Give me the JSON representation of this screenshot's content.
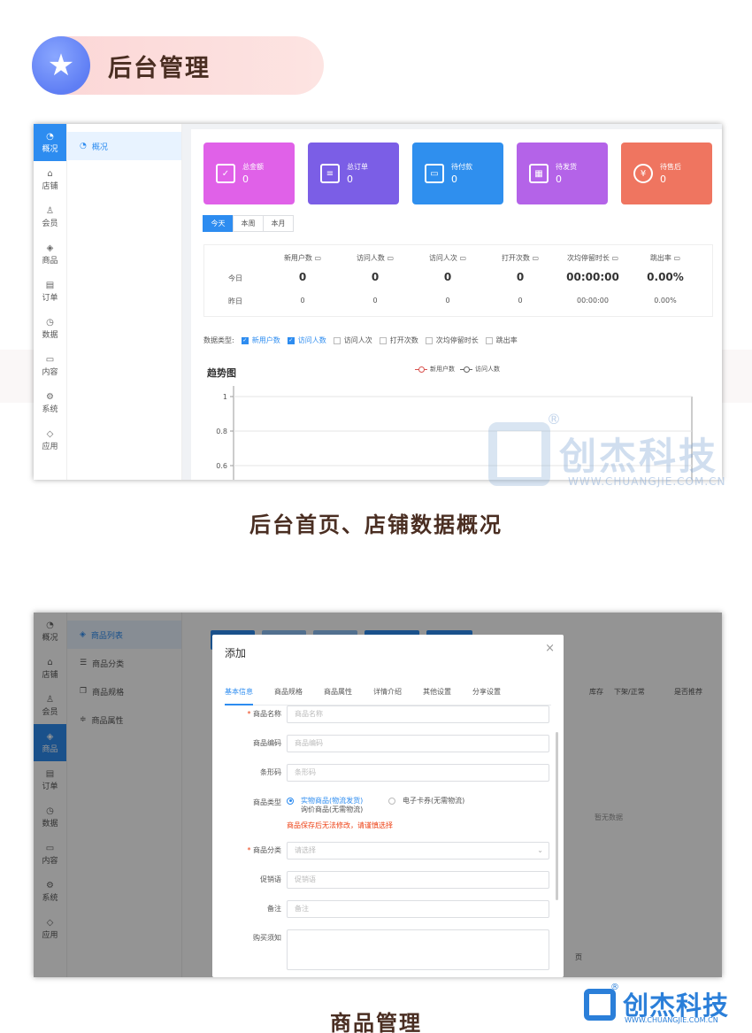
{
  "header": {
    "title": "后台管理",
    "icon": "star-icon"
  },
  "captions": {
    "first": "后台首页、店铺数据概况",
    "second": "商品管理"
  },
  "sidebar": {
    "items": [
      {
        "label": "概况",
        "icon": "gauge-icon"
      },
      {
        "label": "店铺",
        "icon": "store-icon"
      },
      {
        "label": "会员",
        "icon": "user-icon"
      },
      {
        "label": "商品",
        "icon": "cube-icon"
      },
      {
        "label": "订单",
        "icon": "clipboard-icon"
      },
      {
        "label": "数据",
        "icon": "clock-icon"
      },
      {
        "label": "内容",
        "icon": "folder-icon"
      },
      {
        "label": "系统",
        "icon": "gear-icon"
      },
      {
        "label": "应用",
        "icon": "package-icon"
      }
    ]
  },
  "screen1": {
    "subnav": {
      "items": [
        {
          "label": "概况",
          "icon": "gauge-icon"
        }
      ]
    },
    "stats": [
      {
        "label": "总金额",
        "value": "0",
        "color": "#e061e8",
        "icon": "check-square-icon"
      },
      {
        "label": "总订单",
        "value": "0",
        "color": "#7b5ee6",
        "icon": "list-icon"
      },
      {
        "label": "待付款",
        "value": "0",
        "color": "#2f8fee",
        "icon": "wallet-icon"
      },
      {
        "label": "待发货",
        "value": "0",
        "color": "#b463e8",
        "icon": "box-icon"
      },
      {
        "label": "待售后",
        "value": "0",
        "color": "#ef7560",
        "icon": "yen-refresh-icon"
      }
    ],
    "range_tabs": [
      "今天",
      "本周",
      "本月"
    ],
    "range_active": "今天",
    "table": {
      "headers": [
        "新用户数",
        "访问人数",
        "访问人次",
        "打开次数",
        "次均停留时长",
        "跳出率"
      ],
      "rows": [
        {
          "label": "今日",
          "values": [
            "0",
            "0",
            "0",
            "0",
            "00:00:00",
            "0.00%"
          ]
        },
        {
          "label": "昨日",
          "values": [
            "0",
            "0",
            "0",
            "0",
            "00:00:00",
            "0.00%"
          ]
        }
      ]
    },
    "data_type": {
      "label": "数据类型:",
      "options": [
        {
          "label": "新用户数",
          "checked": true
        },
        {
          "label": "访问人数",
          "checked": true
        },
        {
          "label": "访问人次",
          "checked": false
        },
        {
          "label": "打开次数",
          "checked": false
        },
        {
          "label": "次均停留时长",
          "checked": false
        },
        {
          "label": "跳出率",
          "checked": false
        }
      ]
    }
  },
  "chart_data": {
    "type": "line",
    "title": "趋势图",
    "series": [
      {
        "name": "新用户数",
        "color": "#d9534f",
        "values": []
      },
      {
        "name": "访问人数",
        "color": "#666666",
        "values": []
      }
    ],
    "yticks": [
      "1",
      "0.8",
      "0.6"
    ],
    "ylim": [
      0.6,
      1
    ],
    "grid": true,
    "legend": "top-center"
  },
  "watermark": {
    "name": "创杰科技",
    "url": "WWW.CHUANGJIE.COM.CN",
    "reg": "®"
  },
  "screen2": {
    "subnav": {
      "items": [
        {
          "label": "商品列表",
          "icon": "cube-icon"
        },
        {
          "label": "商品分类",
          "icon": "menu-icon"
        },
        {
          "label": "商品规格",
          "icon": "copy-icon"
        },
        {
          "label": "商品属性",
          "icon": "sliders-icon"
        }
      ]
    },
    "background": {
      "columns": [
        "库存",
        "下架/正常",
        "是否推荐"
      ],
      "empty_text": "暂无数据",
      "page_text": "页"
    },
    "modal": {
      "title": "添加",
      "close": "×",
      "tabs": [
        "基本信息",
        "商品规格",
        "商品属性",
        "详情介绍",
        "其他设置",
        "分享设置"
      ],
      "fields": {
        "name": {
          "label": "商品名称",
          "placeholder": "商品名称",
          "required": "*"
        },
        "code": {
          "label": "商品编码",
          "placeholder": "商品编码"
        },
        "barcode": {
          "label": "条形码",
          "placeholder": "条形码"
        },
        "type": {
          "label": "商品类型",
          "options": [
            "实物商品(物流发货)",
            "电子卡券(无需物流)",
            "询价商品(无需物流)"
          ],
          "warning": "商品保存后无法修改，请谨慎选择"
        },
        "category": {
          "label": "商品分类",
          "placeholder": "请选择",
          "required": "*"
        },
        "promo": {
          "label": "促销语",
          "placeholder": "促销语"
        },
        "remark": {
          "label": "备注",
          "placeholder": "备注"
        },
        "notice": {
          "label": "购买须知"
        }
      }
    }
  },
  "logo": {
    "name": "创杰科技",
    "url": "WWW.CHUANGJIE.COM.CN",
    "reg": "®"
  }
}
